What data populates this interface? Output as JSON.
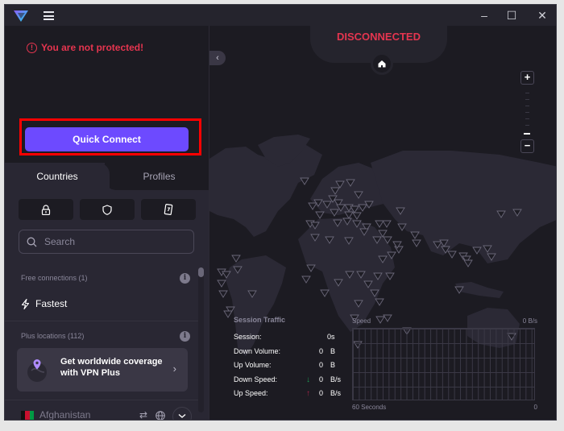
{
  "titlebar": {
    "logo_icon": "protonvpn-logo-icon",
    "menu_icon": "hamburger-menu-icon",
    "minimize": "–",
    "maximize": "☐",
    "close": "✕"
  },
  "status": {
    "warning_text": "You are not protected!",
    "warning_icon": "!",
    "connection_state": "DISCONNECTED",
    "quick_connect_label": "Quick Connect",
    "colors": {
      "danger": "#e5354f",
      "accent": "#6d4aff"
    }
  },
  "tabs": [
    {
      "label": "Countries",
      "active": true
    },
    {
      "label": "Profiles",
      "active": false
    }
  ],
  "filters": [
    {
      "icon": "secure-core-lock-icon"
    },
    {
      "icon": "shield-icon"
    },
    {
      "icon": "p2p-tor-icon"
    }
  ],
  "search": {
    "placeholder": "Search",
    "value": ""
  },
  "lists": {
    "free_header": "Free connections (1)",
    "fastest_label": "Fastest",
    "plus_header": "Plus locations (112)",
    "info_glyph": "i",
    "promo_text": "Get worldwide coverage with VPN Plus",
    "promo_chevron": "›",
    "countries": [
      {
        "name": "Afghanistan"
      }
    ],
    "row_icons": {
      "p2p": "⇄",
      "globe": "🌐",
      "expand": "⌄"
    }
  },
  "map": {
    "collapse_label": "‹",
    "zoom_in": "+",
    "zoom_out": "−"
  },
  "session_traffic": {
    "title": "Session Traffic",
    "rows": [
      {
        "label": "Session:",
        "arrow": "",
        "value": "0s",
        "unit": ""
      },
      {
        "label": "Down Volume:",
        "arrow": "",
        "value": "0",
        "unit": "B"
      },
      {
        "label": "Up Volume:",
        "arrow": "",
        "value": "0",
        "unit": "B"
      },
      {
        "label": "Down Speed:",
        "arrow": "↓",
        "value": "0",
        "unit": "B/s"
      },
      {
        "label": "Up Speed:",
        "arrow": "↑",
        "value": "0",
        "unit": "B/s"
      }
    ]
  },
  "speed_graph": {
    "title": "Speed",
    "max_label": "0  B/s",
    "x_label": "60 Seconds",
    "x_end": "0"
  }
}
